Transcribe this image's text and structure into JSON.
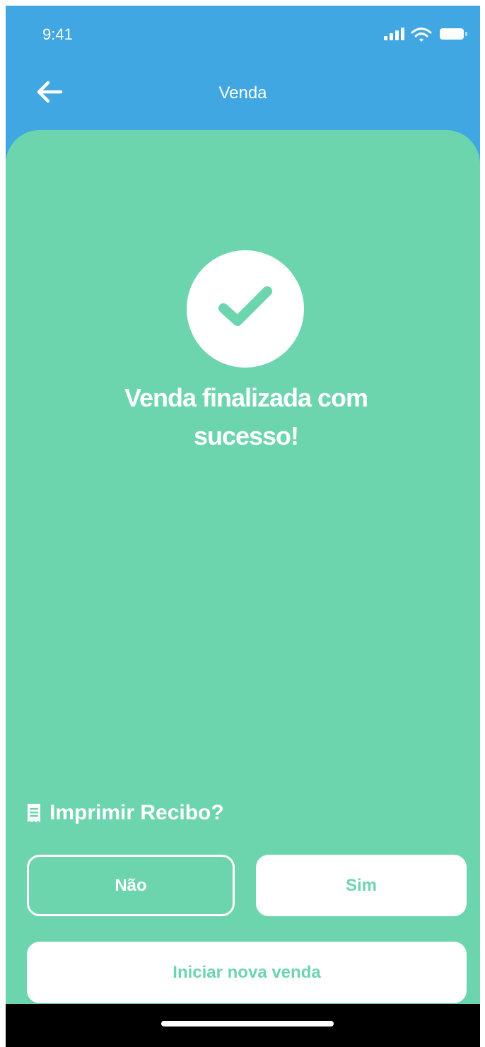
{
  "status_bar": {
    "time": "9:41",
    "icons": [
      "signal-icon",
      "wifi-icon",
      "battery-icon"
    ]
  },
  "header": {
    "title": "Venda",
    "back_icon": "arrow-left-icon"
  },
  "success": {
    "icon": "checkmark-icon",
    "line1": "Venda finalizada com",
    "line2": "sucesso!"
  },
  "receipt": {
    "icon": "receipt-icon",
    "label": "Imprimir Recibo?"
  },
  "buttons": {
    "no_label": "Não",
    "yes_label": "Sim",
    "new_sale_label": "Iniciar nova venda"
  },
  "colors": {
    "header_blue": "#40a7e3",
    "panel_green": "#6dd5ae",
    "white": "#ffffff"
  }
}
